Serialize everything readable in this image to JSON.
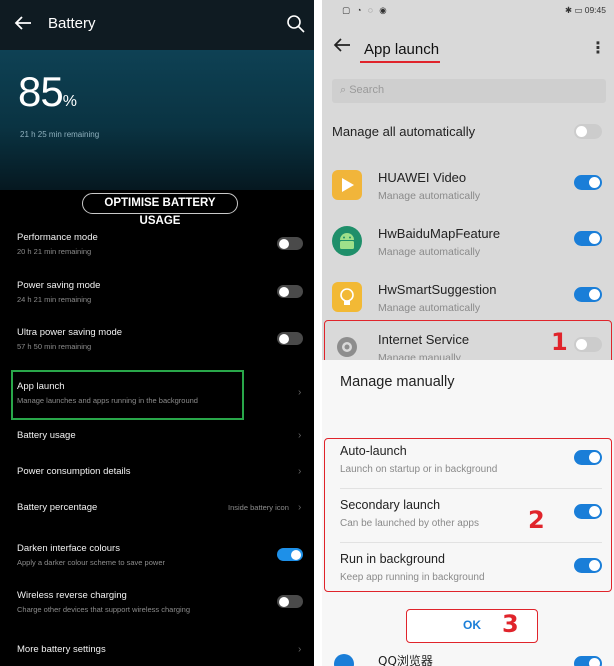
{
  "left": {
    "title": "Battery",
    "percent": "85",
    "percent_sym": "%",
    "remaining": "21 h 25 min remaining",
    "optimise_label": "OPTIMISE BATTERY USAGE",
    "rows": [
      {
        "title": "Performance mode",
        "sub": "20 h 21 min remaining",
        "toggle": false
      },
      {
        "title": "Power saving mode",
        "sub": "24 h 21 min remaining",
        "toggle": false
      },
      {
        "title": "Ultra power saving mode",
        "sub": "57 h 50 min remaining",
        "toggle": false
      },
      {
        "title": "App launch",
        "sub": "Manage launches and apps running in the background"
      },
      {
        "title": "Battery usage"
      },
      {
        "title": "Power consumption details"
      },
      {
        "title": "Battery percentage",
        "value": "Inside battery icon"
      },
      {
        "title": "Darken interface colours",
        "sub": "Apply a darker colour scheme to save power",
        "toggle": true
      },
      {
        "title": "Wireless reverse charging",
        "sub": "Charge other devices that support wireless charging",
        "toggle": false
      },
      {
        "title": "More battery settings"
      }
    ]
  },
  "right": {
    "status_left": "▢ ◔ ◌ ◉",
    "status_right": "✱ ▭ 09:45",
    "title": "App launch",
    "search_placeholder": "Search",
    "manage_all": "Manage all automatically",
    "apps": [
      {
        "name": "HUAWEI Video",
        "sub": "Manage automatically",
        "on": true,
        "color": "#f1b53a"
      },
      {
        "name": "HwBaiduMapFeature",
        "sub": "Manage automatically",
        "on": true,
        "color": "#1f8f6a"
      },
      {
        "name": "HwSmartSuggestion",
        "sub": "Manage automatically",
        "on": true,
        "color": "#f2b935"
      },
      {
        "name": "Internet Service",
        "sub": "Manage manually",
        "on": false,
        "color": "#9a9a9a"
      }
    ],
    "sheet": {
      "title": "Manage manually",
      "options": [
        {
          "title": "Auto-launch",
          "sub": "Launch on startup or in background",
          "on": true
        },
        {
          "title": "Secondary launch",
          "sub": "Can be launched by other apps",
          "on": true
        },
        {
          "title": "Run in background",
          "sub": "Keep app running in background",
          "on": true
        }
      ],
      "ok": "OK",
      "bottom_app": "QQ浏览器"
    },
    "annotations": [
      "1",
      "2",
      "3"
    ],
    "accent": "#1a7ed8",
    "annotation_color": "#e0242b"
  }
}
